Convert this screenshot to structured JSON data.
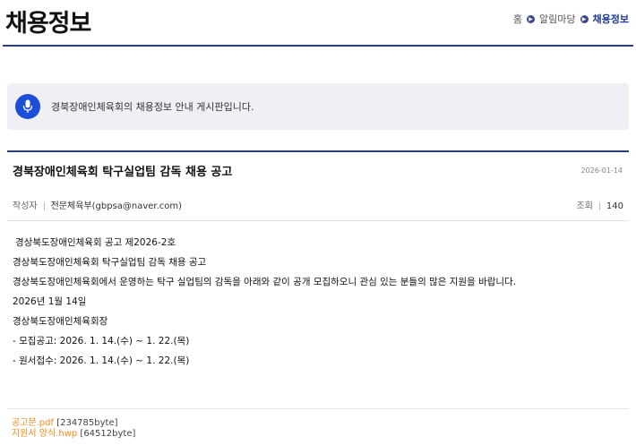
{
  "header": {
    "title": "채용정보",
    "breadcrumb": [
      "홈",
      "알림마당",
      "채용정보"
    ]
  },
  "notice": {
    "icon": "microphone-icon",
    "text": "경북장애인체육회의 채용정보 안내 게시판입니다."
  },
  "post": {
    "title": "경북장애인체육회 탁구실업팀 감독 채용 공고",
    "date": "2026-01-14",
    "author_label": "작성자",
    "author": "전문체육부(gbpsa@naver.com)",
    "views_label": "조회",
    "views": "140",
    "body": [
      "경상북도장애인체육회 공고 제2026-2호",
      "경상북도장애인체육회 탁구실업팀 감독 채용 공고",
      "경상북도장애인체육회에서 운영하는 탁구 실업팀의 감독을 아래와 같이 공개 모집하오니 관심 있는 분들의 많은 지원을 바랍니다.",
      "2026년 1월 14일",
      "경상북도장애인체육회장",
      "- 모집공고: 2026. 1. 14.(수) ~ 1. 22.(목)",
      "- 원서접수: 2026. 1. 14.(수) ~ 1. 22.(목)"
    ],
    "attachments": [
      {
        "name": "공고문.pdf",
        "size": "[234785byte]"
      },
      {
        "name": "지원서 양식.hwp",
        "size": "[64512byte]"
      }
    ]
  },
  "colors": {
    "accent": "#2c3e7a",
    "mic": "#1d4ed8",
    "file_link": "#f08c1c"
  }
}
